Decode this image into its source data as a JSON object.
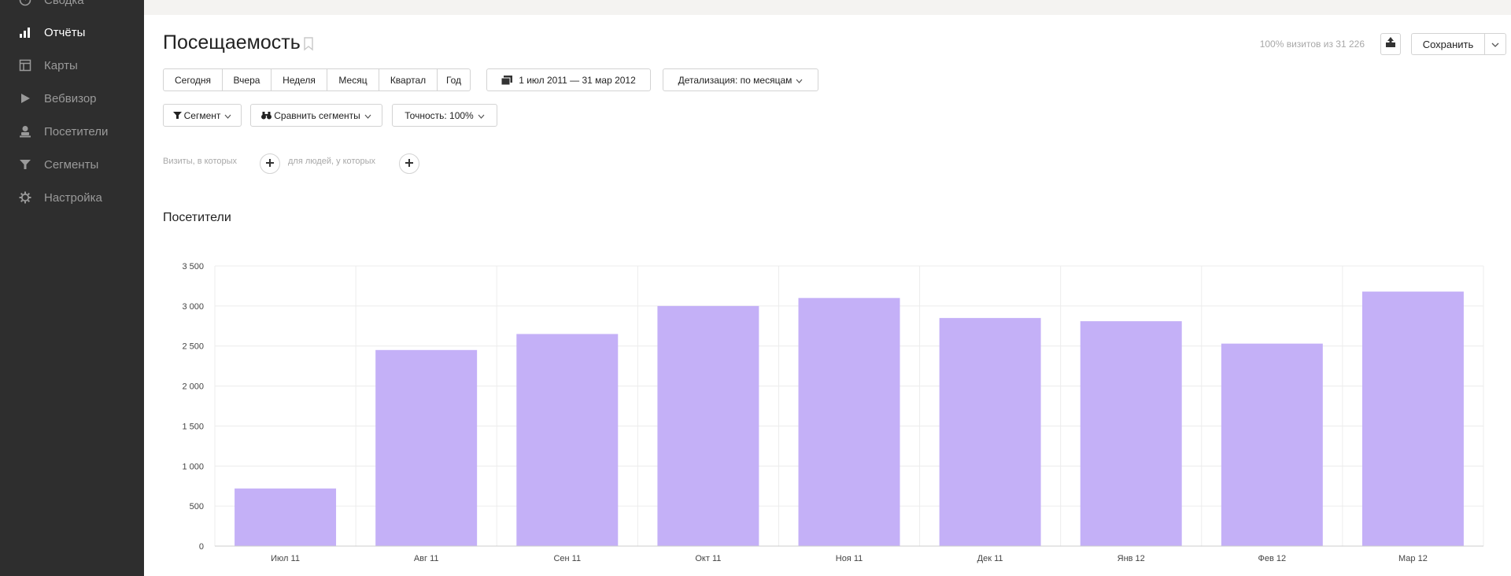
{
  "sidebar": {
    "items": [
      {
        "label": "Сводка",
        "icon": "dashboard-icon"
      },
      {
        "label": "Отчёты",
        "icon": "bar-chart-icon"
      },
      {
        "label": "Карты",
        "icon": "map-icon"
      },
      {
        "label": "Вебвизор",
        "icon": "play-icon"
      },
      {
        "label": "Посетители",
        "icon": "user-icon"
      },
      {
        "label": "Сегменты",
        "icon": "filter-icon"
      },
      {
        "label": "Настройка",
        "icon": "gear-icon"
      }
    ],
    "active_index": 1,
    "bg_color": "#2e2e2e"
  },
  "header": {
    "title": "Посещаемость",
    "visits_info": "100% визитов из 31 226",
    "save_label": "Сохранить"
  },
  "toolbar": {
    "periods": [
      "Сегодня",
      "Вчера",
      "Неделя",
      "Месяц",
      "Квартал",
      "Год"
    ],
    "date_range": "1 июл 2011 — 31 мар 2012",
    "detail": "Детализация: по месяцам",
    "segment": "Сегмент",
    "compare": "Сравнить сегменты",
    "accuracy": "Точность: 100%"
  },
  "filters": {
    "visits_text": "Визиты, в которых",
    "people_text": "для людей, у которых"
  },
  "section": {
    "title": "Посетители"
  },
  "chart_data": {
    "type": "bar",
    "categories": [
      "Июл 11",
      "Авг 11",
      "Сен 11",
      "Окт 11",
      "Ноя 11",
      "Дек 11",
      "Янв 12",
      "Фев 12",
      "Мар 12"
    ],
    "values": [
      720,
      2450,
      2650,
      3000,
      3100,
      2850,
      2810,
      2530,
      3180
    ],
    "ylim": [
      0,
      3500
    ],
    "yticks": [
      0,
      500,
      1000,
      1500,
      2000,
      2500,
      3000,
      3500
    ],
    "ytick_labels": [
      "0",
      "500",
      "1 000",
      "1 500",
      "2 000",
      "2 500",
      "3 000",
      "3 500"
    ],
    "grid": true,
    "bar_color": "#c4b0f7",
    "grid_color": "#ececec"
  }
}
